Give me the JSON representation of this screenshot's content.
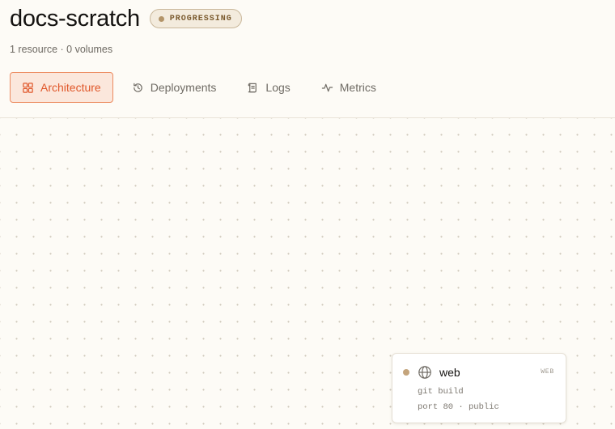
{
  "project": {
    "title": "docs-scratch",
    "status": "PROGRESSING",
    "summary": "1 resource · 0 volumes"
  },
  "tabs": [
    {
      "label": "Architecture",
      "icon": "grid-icon",
      "active": true
    },
    {
      "label": "Deployments",
      "icon": "history-icon",
      "active": false
    },
    {
      "label": "Logs",
      "icon": "scroll-icon",
      "active": false
    },
    {
      "label": "Metrics",
      "icon": "pulse-icon",
      "active": false
    }
  ],
  "node": {
    "name": "web",
    "type": "WEB",
    "icon": "globe-icon",
    "build": "git build",
    "port": "port 80 · public"
  },
  "colors": {
    "accent": "#e0572a",
    "accent_bg": "#fbe7dc",
    "status_dot": "#b39469",
    "background": "#fdfbf6"
  }
}
